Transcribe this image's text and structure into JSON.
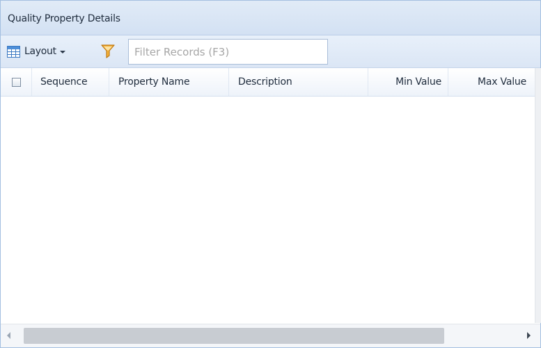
{
  "panel": {
    "title": "Quality Property Details"
  },
  "toolbar": {
    "layout_label": "Layout",
    "layout_icon": "table-layout-icon",
    "filter_icon": "funnel-icon",
    "filter_placeholder": "Filter Records (F3)",
    "filter_value": ""
  },
  "grid": {
    "columns": [
      "Sequence",
      "Property Name",
      "Description",
      "Min Value",
      "Max Value"
    ],
    "rows": []
  },
  "colors": {
    "header_bg": "#dbe6f5",
    "border": "#a3bfe0",
    "scroll_thumb": "#c8ccd2"
  }
}
